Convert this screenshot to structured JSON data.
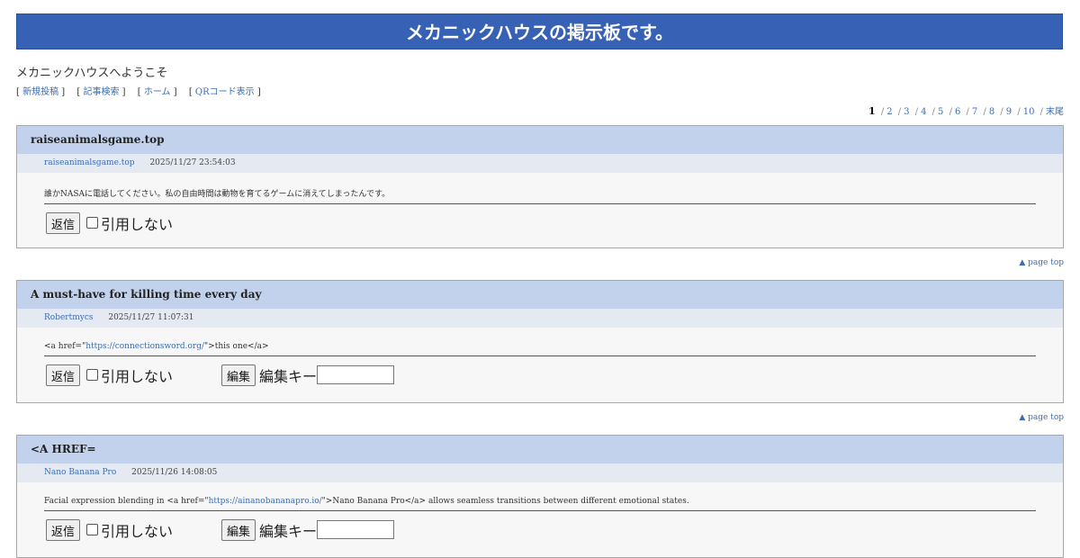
{
  "header": {
    "title": "メカニックハウスの掲示板です。"
  },
  "welcome": "メカニックハウスへようこそ",
  "nav": [
    {
      "label": "新規投稿"
    },
    {
      "label": "記事検索"
    },
    {
      "label": "ホーム"
    },
    {
      "label": "QRコード表示"
    }
  ],
  "pager": {
    "current": "1",
    "pages": [
      "2",
      "3",
      "4",
      "5",
      "6",
      "7",
      "8",
      "9",
      "10"
    ],
    "last": "末尾"
  },
  "labels": {
    "reply": "返信",
    "no_quote": "引用しない",
    "edit": "編集",
    "edit_key": "編集キー",
    "page_top": "▲ page top"
  },
  "posts": [
    {
      "title": "raiseanimalsgame.top",
      "author": "raiseanimalsgame.top",
      "date": "2025/11/27 23:54:03",
      "body": "誰かNASAに電話してください。私の自由時間は動物を育てるゲームに消えてしまったんです。"
    },
    {
      "title": "A must-have for killing time every day",
      "author": "Robertmycs",
      "date": "2025/11/27 11:07:31",
      "body_pre": "<a href=\"",
      "body_link": "https://connectionsword.org/",
      "body_post": "\">this one</a>"
    },
    {
      "title": "<A HREF=",
      "author": "Nano Banana Pro",
      "date": "2025/11/26 14:08:05",
      "body_pre": "Facial expression blending in <a href=\"",
      "body_link": "https://ainanobananapro.io/",
      "body_post": "\">Nano Banana Pro</a> allows seamless transitions between different emotional states."
    }
  ]
}
